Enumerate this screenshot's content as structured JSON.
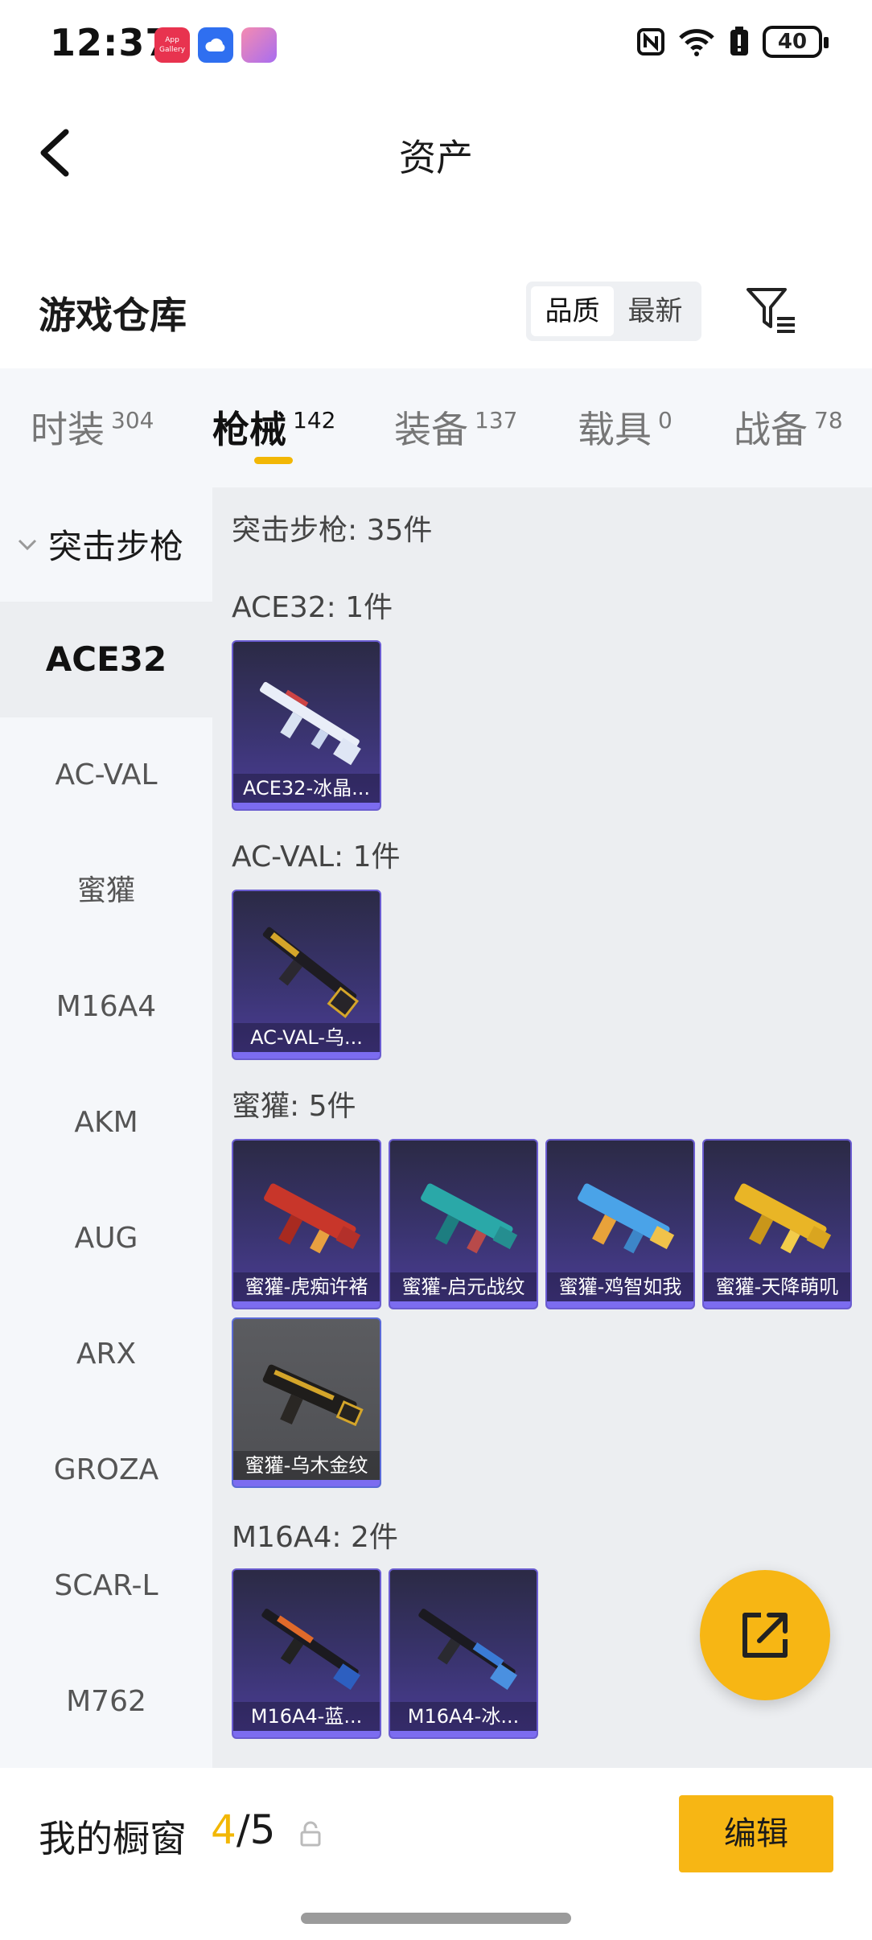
{
  "status_bar": {
    "time": "12:37",
    "app_icons": [
      "app-gallery-icon",
      "cloud-icon",
      "gallery-icon"
    ],
    "battery_level": "40",
    "indicators": [
      "nfc-icon",
      "wifi-icon",
      "battery-alert-icon"
    ]
  },
  "header": {
    "title": "资产"
  },
  "warehouse": {
    "title": "游戏仓库",
    "sort_options": [
      "品质",
      "最新"
    ],
    "active_sort": "品质"
  },
  "tabs": [
    {
      "label": "时装",
      "count": "304"
    },
    {
      "label": "枪械",
      "count": "142"
    },
    {
      "label": "装备",
      "count": "137"
    },
    {
      "label": "载具",
      "count": "0"
    },
    {
      "label": "战备",
      "count": "78"
    }
  ],
  "sidebar": {
    "category": "突击步枪",
    "items": [
      "ACE32",
      "AC-VAL",
      "蜜獾",
      "M16A4",
      "AKM",
      "AUG",
      "ARX",
      "GROZA",
      "SCAR-L",
      "M762"
    ]
  },
  "content": {
    "summary": "突击步枪: 35件",
    "sections": [
      {
        "title": "ACE32: 1件",
        "items": [
          "ACE32-冰晶..."
        ]
      },
      {
        "title": "AC-VAL: 1件",
        "items": [
          "AC-VAL-乌..."
        ]
      },
      {
        "title": "蜜獾: 5件",
        "items": [
          "蜜獾-虎痴许褚",
          "蜜獾-启元战纹",
          "蜜獾-鸡智如我",
          "蜜獾-天降萌叽",
          "蜜獾-乌木金纹"
        ]
      },
      {
        "title": "M16A4: 2件",
        "items": [
          "M16A4-蓝...",
          "M16A4-冰..."
        ]
      }
    ]
  },
  "showcase": {
    "title": "我的橱窗",
    "current": "4",
    "separator": "/",
    "total": "5",
    "edit_label": "编辑"
  },
  "colors": {
    "accent": "#f7b614",
    "card_purple": "#4b3d96",
    "background_gray": "#eceef1"
  }
}
